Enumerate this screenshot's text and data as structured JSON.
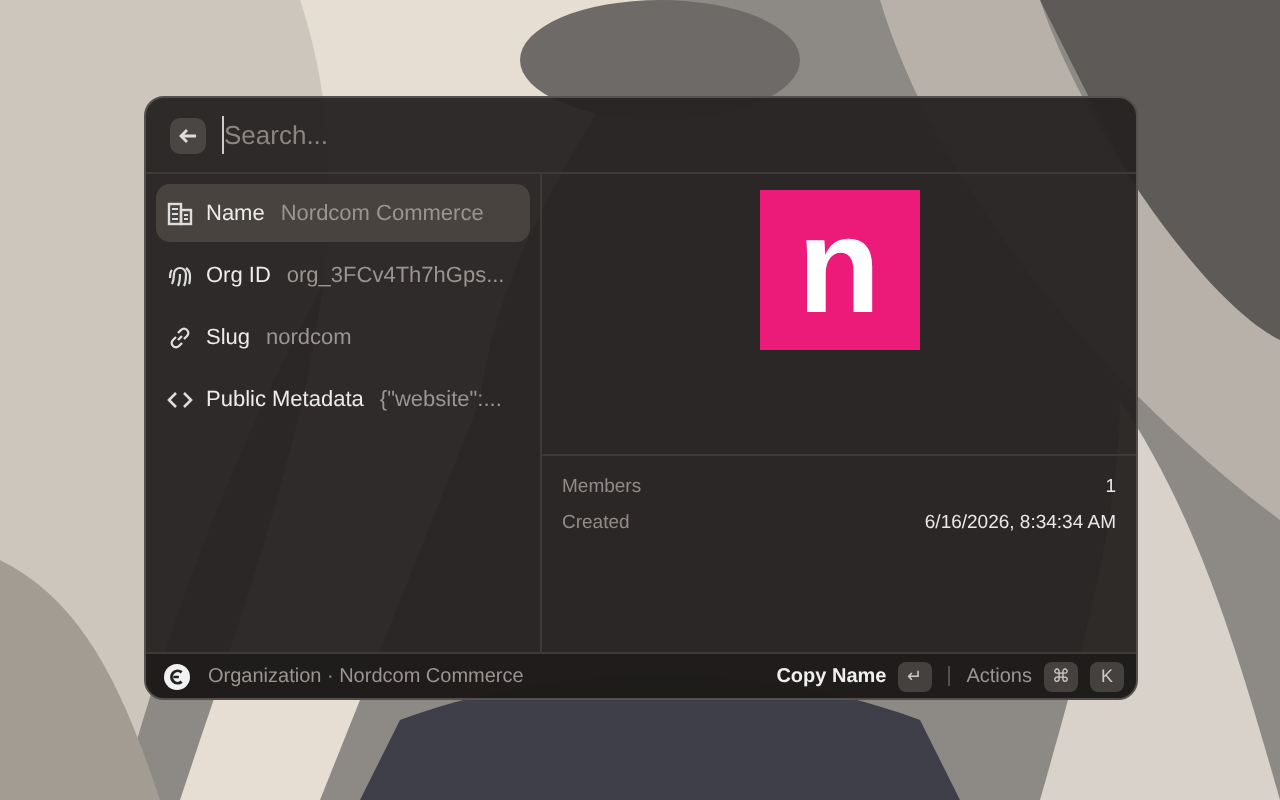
{
  "search": {
    "placeholder": "Search..."
  },
  "items": [
    {
      "kind": "name",
      "label": "Name",
      "value": "Nordcom Commerce",
      "selected": true
    },
    {
      "kind": "identifier",
      "label": "Org ID",
      "value": "org_3FCv4Th7hGps...",
      "selected": false
    },
    {
      "kind": "slug",
      "label": "Slug",
      "value": "nordcom",
      "selected": false
    },
    {
      "kind": "metadata",
      "label": "Public Metadata",
      "value": "{\"website\":...",
      "selected": false
    }
  ],
  "detail": {
    "logo": {
      "letter": "n",
      "color": "#ec1b7a"
    },
    "metadata": [
      {
        "label": "Members",
        "value": "1"
      },
      {
        "label": "Created",
        "value": "6/16/2026, 8:34:34 AM"
      }
    ]
  },
  "footer": {
    "title": "Organization · Nordcom Commerce",
    "primary_action": "Copy Name",
    "primary_key": "↵",
    "actions_label": "Actions",
    "action_keys": [
      "⌘",
      "K"
    ]
  }
}
